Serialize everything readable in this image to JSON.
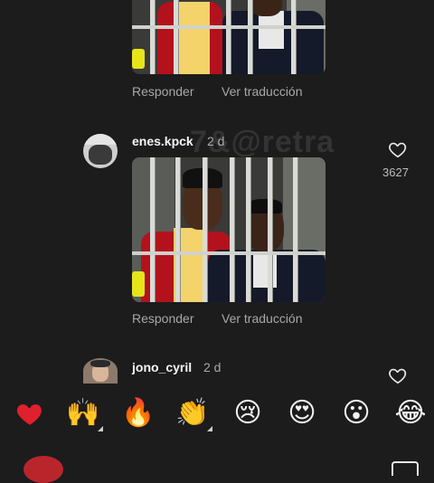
{
  "comments": [
    {
      "actions": {
        "reply": "Responder",
        "translate": "Ver traducción"
      }
    },
    {
      "username": "enes.kpck",
      "time": "2 d",
      "likes": "3627",
      "actions": {
        "reply": "Responder",
        "translate": "Ver traducción"
      }
    },
    {
      "username": "jono_cyril",
      "time": "2 d"
    }
  ],
  "watermark": "7&@retra",
  "reactions": [
    {
      "name": "red-heart",
      "glyph": "❤️",
      "color": "#e0202e"
    },
    {
      "name": "raising-hands",
      "glyph": "🙌"
    },
    {
      "name": "fire",
      "glyph": "🔥"
    },
    {
      "name": "clapping-hands",
      "glyph": "👏"
    },
    {
      "name": "crying-face",
      "glyph": "😢"
    },
    {
      "name": "heart-eyes",
      "glyph": "😍"
    },
    {
      "name": "surprised-face",
      "glyph": "😮"
    },
    {
      "name": "laughing-tears",
      "glyph": "😂"
    }
  ],
  "icons": {
    "like": "heart-outline-icon",
    "gif_picker": "gif-icon"
  },
  "colors": {
    "background": "#1c1c1c",
    "secondary_text": "#a8a8a8"
  }
}
